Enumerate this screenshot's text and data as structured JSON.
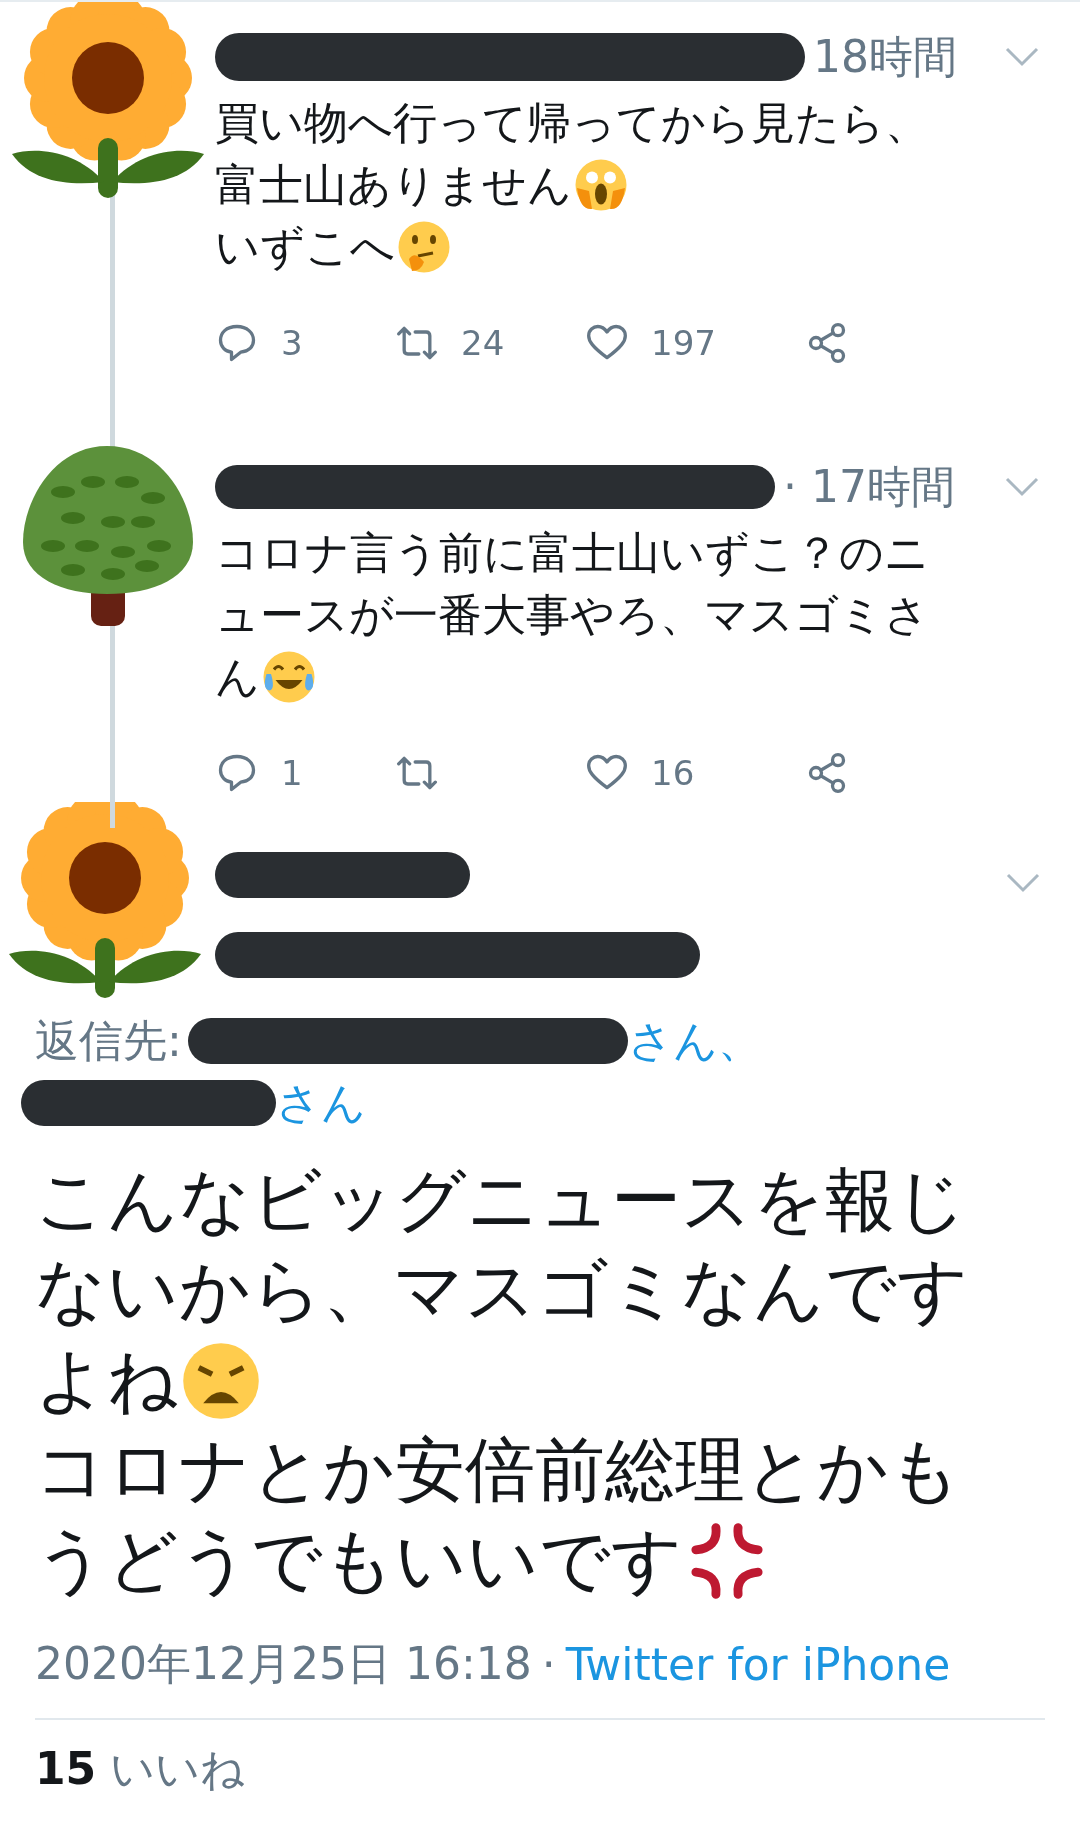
{
  "thread": [
    {
      "avatar": {
        "kind": "sunflower"
      },
      "time": "18時間",
      "lines": [
        {
          "text": "買い物へ行って帰ってから見たら、"
        },
        {
          "text": "富士山ありません",
          "emoji": {
            "kind": "scream"
          }
        },
        {
          "text": "いずこへ",
          "emoji": {
            "kind": "thinking"
          }
        }
      ],
      "actions": [
        {
          "kind": "reply",
          "count": "3"
        },
        {
          "kind": "retweet",
          "count": "24"
        },
        {
          "kind": "like",
          "count": "197"
        },
        {
          "kind": "share"
        }
      ]
    },
    {
      "avatar": {
        "kind": "tree"
      },
      "time": "· 17時間",
      "lines": [
        {
          "text": "コロナ言う前に富士山いずこ？のニ"
        },
        {
          "text": "ュースが一番大事やろ、マスゴミさ"
        },
        {
          "text": "ん",
          "emoji": {
            "kind": "joy"
          }
        }
      ],
      "actions": [
        {
          "kind": "reply",
          "count": "1"
        },
        {
          "kind": "retweet"
        },
        {
          "kind": "like",
          "count": "16"
        },
        {
          "kind": "share"
        }
      ]
    }
  ],
  "main_tweet": {
    "avatar": {
      "kind": "sunflower"
    },
    "reply_to": {
      "label": "返信先:",
      "suffixes": [
        "さん、",
        "さん"
      ]
    },
    "lines": [
      {
        "text": "こんなビッグニュースを報じ"
      },
      {
        "text": "ないから、マスゴミなんです"
      },
      {
        "text": "よね",
        "emoji": {
          "kind": "weary"
        }
      },
      {
        "text": "コロナとか安倍前総理とかも"
      },
      {
        "text": "うどうでもいいです",
        "emoji": {
          "kind": "anger"
        }
      }
    ],
    "date": "2020年12月25日 16:18",
    "separator": "·",
    "source": "Twitter for iPhone",
    "likes": {
      "count": "15",
      "label": "いいね"
    }
  }
}
